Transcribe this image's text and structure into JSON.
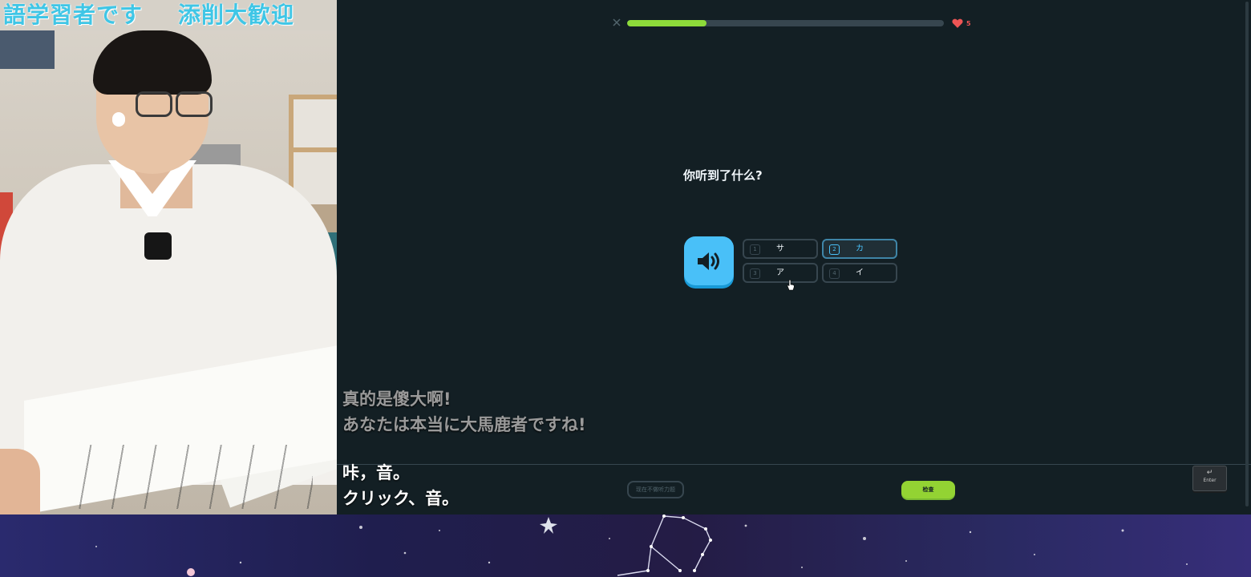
{
  "webcam": {
    "banner_left": "語学習者です",
    "banner_right": "添削大歓迎"
  },
  "lesson": {
    "progress_fraction": 0.25,
    "hearts": "5",
    "prompt": "你听到了什么?",
    "choices": [
      {
        "num": "1",
        "label": "サ"
      },
      {
        "num": "2",
        "label": "カ",
        "selected": true
      },
      {
        "num": "3",
        "label": "ア"
      },
      {
        "num": "4",
        "label": "イ"
      }
    ],
    "skip_label": "现在不做听力题",
    "check_label": "检查",
    "enter_label": "Enter"
  },
  "subtitles": {
    "grey_line1": "真的是傻大啊!",
    "grey_line2": "あなたは本当に大馬鹿者ですね!",
    "white_line1": "咔，音。",
    "white_line2": "クリック、音。"
  },
  "colors": {
    "background": "#131f24",
    "progress": "#8ddb3a",
    "audio_button": "#49c0f8",
    "check_button": "#93d333",
    "heart": "#ee5555"
  },
  "icons": [
    "close-icon",
    "heart-icon",
    "speaker-icon",
    "enter-arrow-icon",
    "hand-cursor-icon"
  ]
}
